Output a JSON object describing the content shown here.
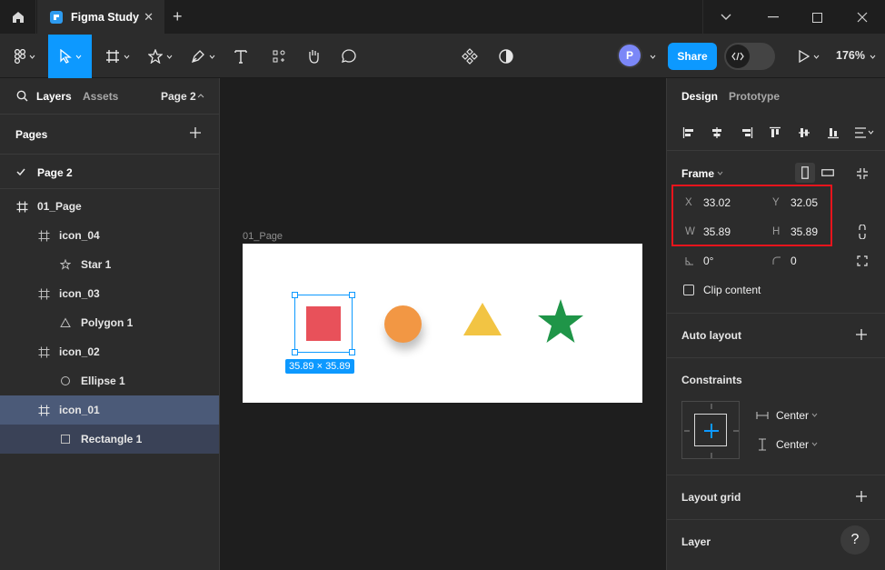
{
  "tab": {
    "title": "Figma Study"
  },
  "toolbar": {
    "avatar_initial": "P",
    "share_label": "Share",
    "zoom": "176%"
  },
  "left_panel": {
    "tabs": {
      "layers": "Layers",
      "assets": "Assets",
      "page_selector": "Page 2"
    },
    "pages_title": "Pages",
    "pages": [
      {
        "label": "Page 2"
      }
    ],
    "layers": [
      {
        "label": "01_Page",
        "type": "frame"
      },
      {
        "label": "icon_04",
        "type": "frame"
      },
      {
        "label": "Star 1",
        "type": "star"
      },
      {
        "label": "icon_03",
        "type": "frame"
      },
      {
        "label": "Polygon 1",
        "type": "polygon"
      },
      {
        "label": "icon_02",
        "type": "frame"
      },
      {
        "label": "Ellipse 1",
        "type": "ellipse"
      },
      {
        "label": "icon_01",
        "type": "frame"
      },
      {
        "label": "Rectangle 1",
        "type": "rectangle"
      }
    ]
  },
  "canvas": {
    "frame_name": "01_Page",
    "selection_size": "35.89 × 35.89",
    "colors": {
      "rect": "#e8515a",
      "circle": "#f29744",
      "triangle": "#f2c443",
      "star": "#1f9548",
      "accent": "#0d99ff"
    }
  },
  "right_panel": {
    "tabs": {
      "design": "Design",
      "prototype": "Prototype"
    },
    "frame_label": "Frame",
    "x_label": "X",
    "x_value": "33.02",
    "y_label": "Y",
    "y_value": "32.05",
    "w_label": "W",
    "w_value": "35.89",
    "h_label": "H",
    "h_value": "35.89",
    "rotation": "0°",
    "radius": "0",
    "clip_content_label": "Clip content",
    "auto_layout_label": "Auto layout",
    "constraints_label": "Constraints",
    "constraint_h": "Center",
    "constraint_v": "Center",
    "layout_grid_label": "Layout grid",
    "layer_label": "Layer",
    "help_label": "?"
  }
}
